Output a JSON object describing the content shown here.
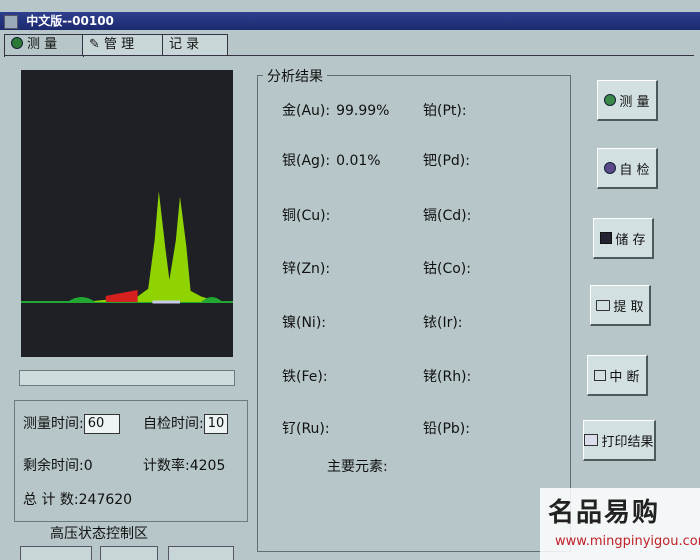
{
  "window": {
    "title": "中文版--00100"
  },
  "tabs": [
    {
      "label": "测 量"
    },
    {
      "label": "管 理"
    },
    {
      "label": "记 录"
    }
  ],
  "chart_data": {
    "type": "line",
    "title": "",
    "xlabel": "",
    "ylabel": "",
    "note_colors": [
      "#8fd400",
      "#d62020",
      "#22a832",
      "#c8c8e8"
    ],
    "x": [
      0,
      10,
      20,
      30,
      40,
      50,
      55,
      60,
      63,
      65,
      68,
      70,
      73,
      75,
      78,
      80,
      85,
      90,
      95,
      100
    ],
    "series": [
      {
        "values": [
          0,
          0,
          0,
          0,
          0.02,
          0.03,
          0.05,
          0.12,
          0.55,
          1.0,
          0.5,
          0.2,
          0.55,
          0.95,
          0.5,
          0.1,
          0.05,
          0.02,
          0,
          0
        ]
      }
    ],
    "ylim": [
      0,
      1.1
    ],
    "xlim": [
      0,
      100
    ]
  },
  "controls": {
    "measure_time_label": "测量时间:",
    "measure_time_value": "60",
    "selfcheck_time_label": "自检时间:",
    "selfcheck_time_value": "10",
    "remaining_label": "剩余时间:",
    "remaining_value": "0",
    "count_rate_label": "计数率:",
    "count_rate_value": "4205",
    "total_label": "总 计 数:",
    "total_value": "247620",
    "hv_label": "高压状态控制区"
  },
  "results": {
    "title": "分析结果",
    "left": [
      {
        "label": "金(Au):",
        "value": "99.99%"
      },
      {
        "label": "银(Ag):",
        "value": "0.01%"
      },
      {
        "label": "铜(Cu):",
        "value": ""
      },
      {
        "label": "锌(Zn):",
        "value": ""
      },
      {
        "label": "镍(Ni):",
        "value": ""
      },
      {
        "label": "铁(Fe):",
        "value": ""
      },
      {
        "label": "钌(Ru):",
        "value": ""
      }
    ],
    "right": [
      {
        "label": "铂(Pt):",
        "value": ""
      },
      {
        "label": "钯(Pd):",
        "value": ""
      },
      {
        "label": "镉(Cd):",
        "value": ""
      },
      {
        "label": "钴(Co):",
        "value": ""
      },
      {
        "label": "铱(Ir):",
        "value": ""
      },
      {
        "label": "铑(Rh):",
        "value": ""
      },
      {
        "label": "铅(Pb):",
        "value": ""
      }
    ],
    "main_elements_label": "主要元素:"
  },
  "buttons": {
    "measure": "测 量",
    "selfcheck": "自 检",
    "save": "储 存",
    "extract": "提 取",
    "interrupt": "中 断",
    "print": "打印结果"
  },
  "watermark": {
    "brand": "名品易购",
    "url": "www.mingpinyigou.com"
  }
}
